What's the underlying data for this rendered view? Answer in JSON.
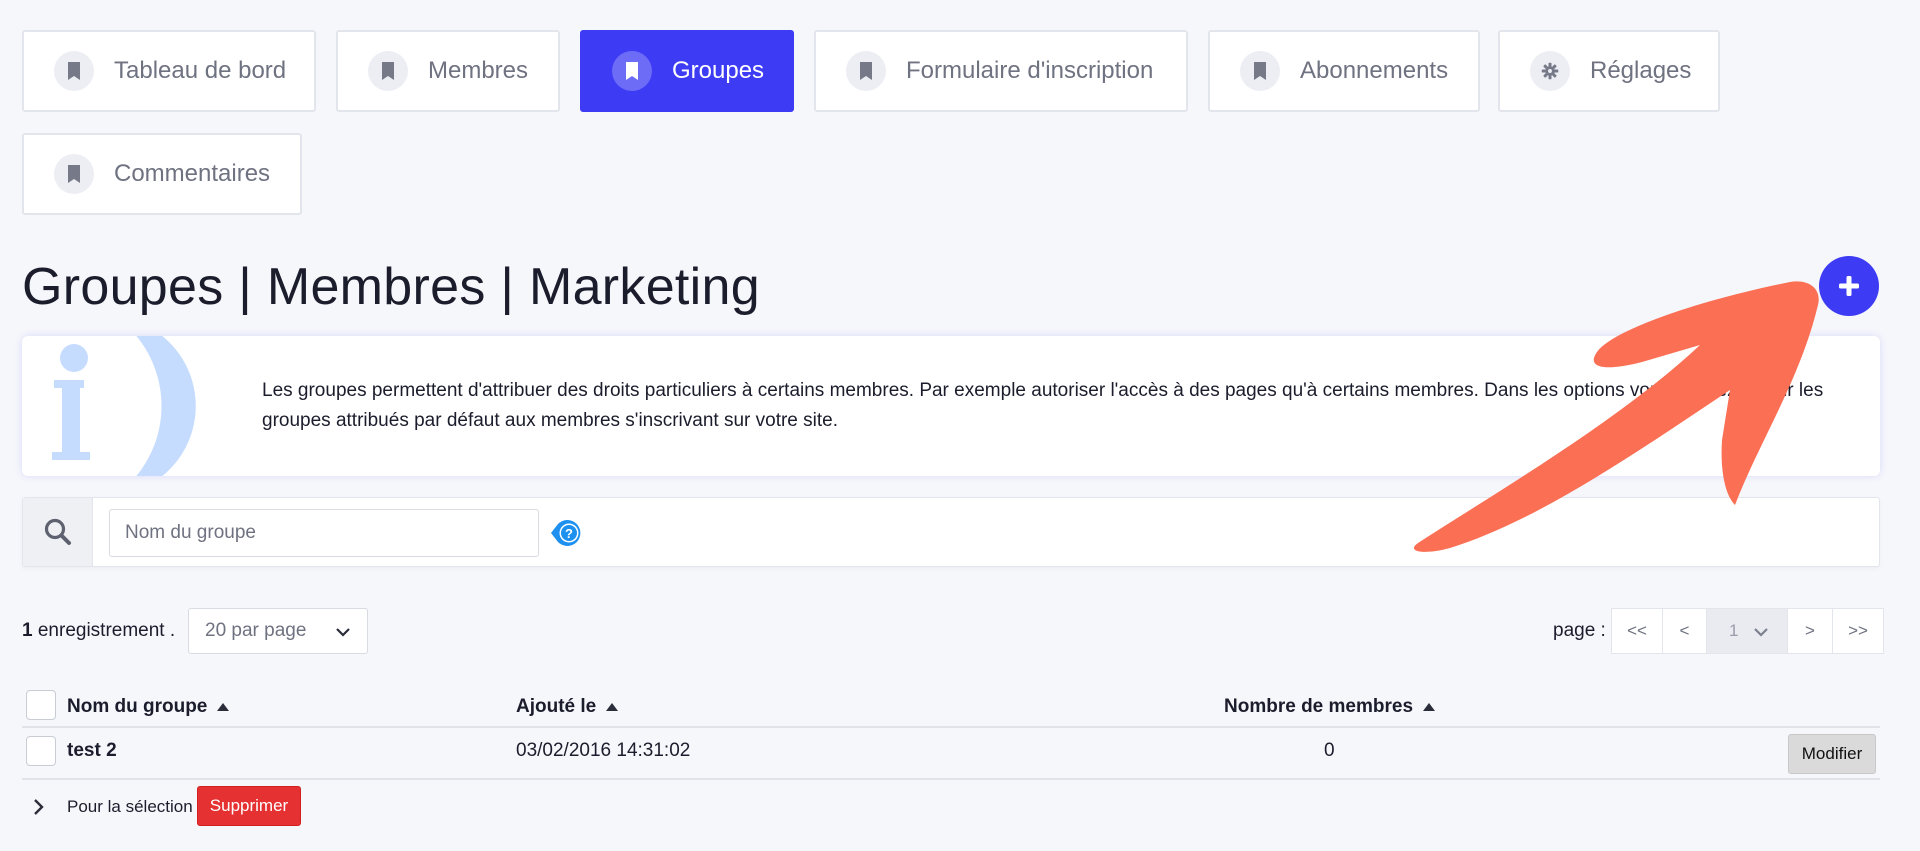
{
  "tabs": [
    {
      "label": "Tableau de bord",
      "icon": "bookmark-icon",
      "active": false
    },
    {
      "label": "Membres",
      "icon": "bookmark-icon",
      "active": false
    },
    {
      "label": "Groupes",
      "icon": "bookmark-icon",
      "active": true
    },
    {
      "label": "Formulaire d'inscription",
      "icon": "bookmark-icon",
      "active": false
    },
    {
      "label": "Abonnements",
      "icon": "bookmark-icon",
      "active": false
    },
    {
      "label": "Réglages",
      "icon": "gear-icon",
      "active": false
    },
    {
      "label": "Commentaires",
      "icon": "bookmark-icon",
      "active": false
    }
  ],
  "page": {
    "title": "Groupes | Membres | Marketing",
    "add_icon": "plus-icon"
  },
  "info": {
    "icon": "info-icon",
    "text": "Les groupes permettent d'attribuer des droits particuliers à certains membres. Par exemple autoriser l'accès à des pages qu'à certains membres. Dans les options vous pouvez définir les groupes attribués par défaut aux membres s'inscrivant sur votre site."
  },
  "search": {
    "icon": "search-icon",
    "placeholder": "Nom du groupe",
    "value": "",
    "help_icon": "help-icon"
  },
  "records": {
    "count": "1",
    "label": "enregistrement .",
    "per_page": "20 par page"
  },
  "pager": {
    "label": "page :",
    "first": "<<",
    "prev": "<",
    "current": "1",
    "next": ">",
    "last": ">>"
  },
  "table": {
    "columns": [
      "Nom du groupe",
      "Ajouté le",
      "Nombre de membres"
    ],
    "rows": [
      {
        "name": "test 2",
        "added": "03/02/2016 14:31:02",
        "members": "0",
        "action": "Modifier"
      }
    ],
    "footer": {
      "selection_label": "Pour la sélection",
      "delete_label": "Supprimer"
    }
  },
  "colors": {
    "accent": "#3d3bf3",
    "danger": "#e53131",
    "annotation": "#fb6f54",
    "info_graphic": "#c6dcff",
    "help": "#1e90f0"
  }
}
